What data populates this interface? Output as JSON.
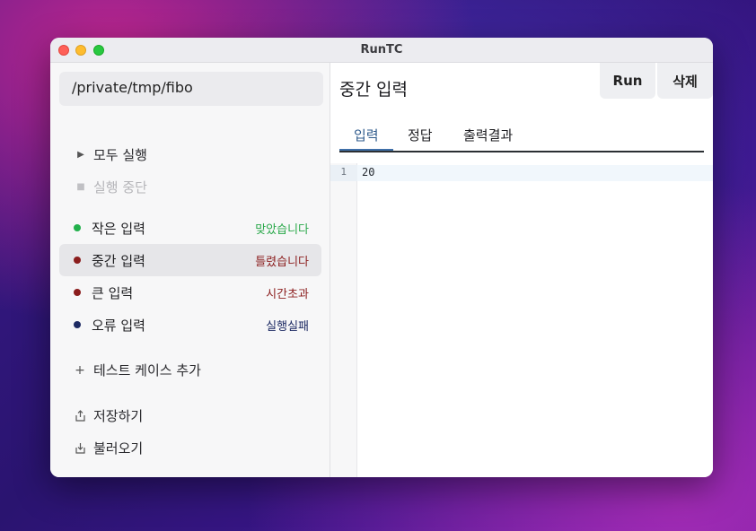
{
  "window": {
    "title": "RunTC"
  },
  "sidebar": {
    "path": "/private/tmp/fibo",
    "run_all": "모두 실행",
    "stop_run": "실행 중단",
    "cases": [
      {
        "name": "작은 입력",
        "status": "맞았습니다",
        "dot_color": "#22b14c",
        "status_color": "#2aa84a"
      },
      {
        "name": "중간 입력",
        "status": "틀렸습니다",
        "dot_color": "#8b1d1d",
        "status_color": "#8b1d1d"
      },
      {
        "name": "큰 입력",
        "status": "시간초과",
        "dot_color": "#8b1d1d",
        "status_color": "#8b1d1d"
      },
      {
        "name": "오류 입력",
        "status": "실행실패",
        "dot_color": "#1d2a63",
        "status_color": "#1d2a63"
      }
    ],
    "add_case": "테스트 케이스 추가",
    "save": "저장하기",
    "load": "불러오기"
  },
  "main": {
    "title": "중간 입력",
    "run_button": "Run",
    "delete_button": "삭제",
    "tabs": [
      {
        "label": "입력",
        "active": true
      },
      {
        "label": "정답",
        "active": false
      },
      {
        "label": "출력결과",
        "active": false
      }
    ],
    "editor": {
      "line_number": "1",
      "content": "20"
    }
  },
  "colors": {
    "accent": "#3f6fa8",
    "close": "#fe5f57",
    "minimize": "#febc2e",
    "zoom": "#28c840"
  }
}
